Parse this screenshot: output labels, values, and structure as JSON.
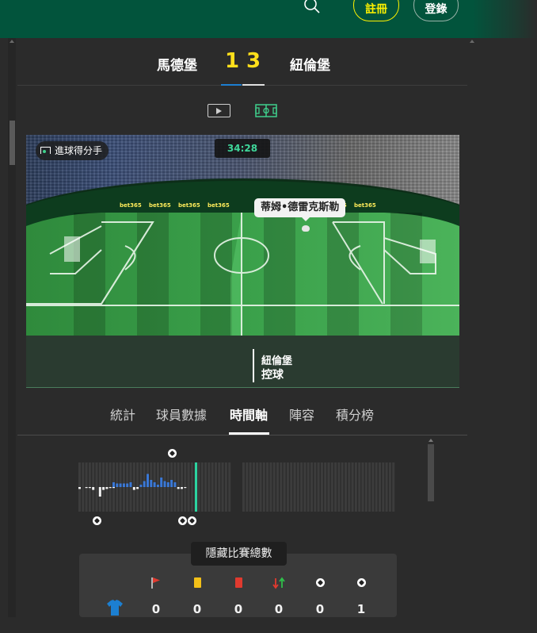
{
  "header": {
    "register_label": "註冊",
    "login_label": "登錄"
  },
  "match": {
    "home_team": "馬德堡",
    "away_team": "紐倫堡",
    "home_score": "1",
    "away_score": "3"
  },
  "pitch": {
    "scorer_chip_label": "進球得分手",
    "clock": "34:28",
    "player_name": "蒂姆•德雷克斯勒",
    "possession_team": "紐倫堡",
    "possession_state": "控球",
    "board_text": "bet365"
  },
  "tabs": [
    {
      "label": "統計"
    },
    {
      "label": "球員數據"
    },
    {
      "label": "時間軸"
    },
    {
      "label": "陣容"
    },
    {
      "label": "積分榜"
    }
  ],
  "active_tab": "時間軸",
  "timeline": {
    "home_goal_markers": 1,
    "away_goal_markers": 3
  },
  "tooltip": "隱藏比賽總數",
  "stats": {
    "columns": [
      {
        "icon": "corner-flag-icon",
        "value": "0"
      },
      {
        "icon": "yellow-card-icon",
        "value": "0"
      },
      {
        "icon": "red-card-icon",
        "value": "0"
      },
      {
        "icon": "substitution-icon",
        "value": "0"
      },
      {
        "icon": "goal-ball-icon",
        "value": "0"
      },
      {
        "icon": "goal-ball-icon",
        "value": "1"
      }
    ]
  },
  "colors": {
    "brand_green": "#02543c",
    "score_yellow": "#ffdf1b",
    "clock_green": "#3fd69a",
    "home_blue": "#1c7fd1",
    "bar_blue": "#3a78d6"
  }
}
